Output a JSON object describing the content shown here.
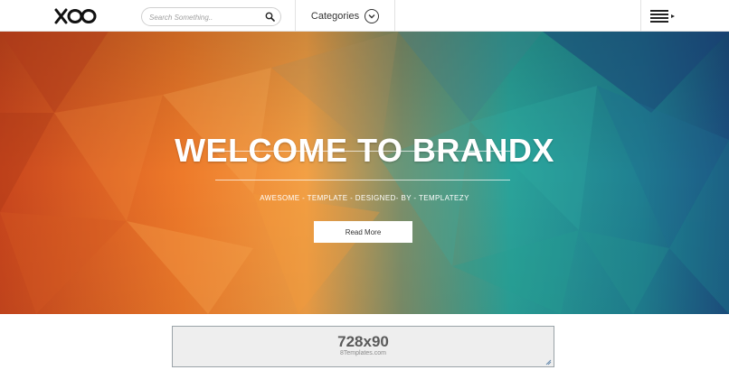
{
  "header": {
    "logo_icon": "xoo-logo",
    "search_placeholder": "Search Something..",
    "search_icon": "search-icon",
    "categories_label": "Categories",
    "categories_icon": "chevron-down-circle-icon",
    "menu_icon": "hamburger-menu-icon"
  },
  "hero": {
    "title": "WELCOME TO BRANDX",
    "subtitle": "AWESOME - TEMPLATE - DESIGNED- BY - TEMPLATEZY",
    "button_label": "Read More",
    "colors": {
      "warm": "#f28a2e",
      "cool": "#2aa39a",
      "deep": "#1f4f7a"
    }
  },
  "ad": {
    "size_text": "728x90",
    "source_text": "8Templates.com"
  }
}
